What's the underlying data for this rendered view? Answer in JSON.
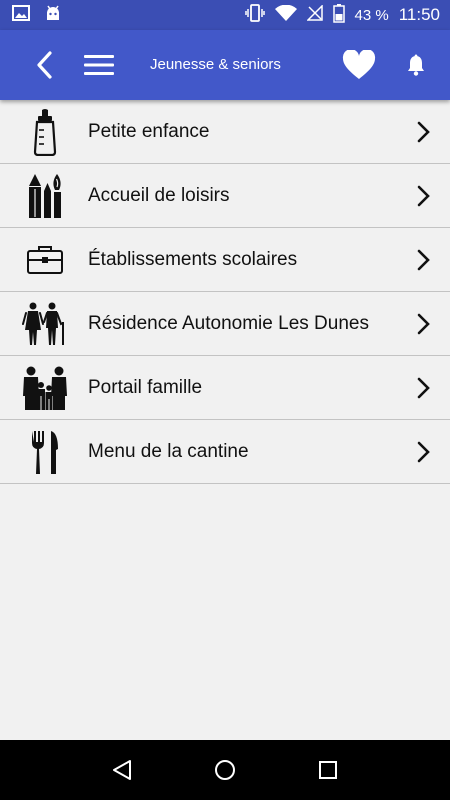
{
  "status_bar": {
    "battery": "43 %",
    "time": "11:50"
  },
  "app_bar": {
    "title": "Jeunesse & seniors"
  },
  "menu": {
    "items": [
      {
        "label": "Petite enfance",
        "icon": "baby-bottle-icon"
      },
      {
        "label": "Accueil de loisirs",
        "icon": "art-supplies-icon"
      },
      {
        "label": "Établissements scolaires",
        "icon": "briefcase-icon"
      },
      {
        "label": "Résidence Autonomie Les Dunes",
        "icon": "elderly-couple-icon"
      },
      {
        "label": "Portail famille",
        "icon": "family-icon"
      },
      {
        "label": "Menu de la cantine",
        "icon": "fork-knife-icon"
      }
    ]
  },
  "colors": {
    "status_bar": "#3b4eb4",
    "app_bar": "#4258c9",
    "background": "#f1f1f1",
    "divider": "#c3c3c3"
  }
}
